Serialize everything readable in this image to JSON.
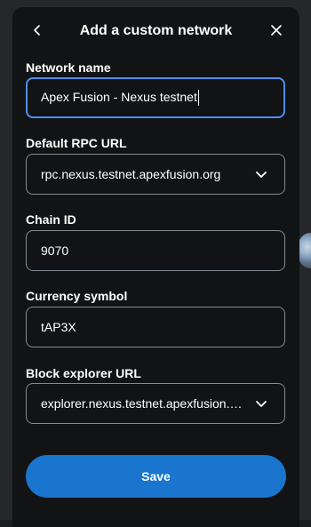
{
  "header": {
    "title": "Add a custom network",
    "back_icon": "chevron-left-icon",
    "close_icon": "close-icon"
  },
  "form": {
    "network_name": {
      "label": "Network name",
      "value": "Apex Fusion - Nexus testnet"
    },
    "rpc_url": {
      "label": "Default RPC URL",
      "value": "rpc.nexus.testnet.apexfusion.org",
      "icon": "chevron-down-icon"
    },
    "chain_id": {
      "label": "Chain ID",
      "value": "9070"
    },
    "currency_symbol": {
      "label": "Currency symbol",
      "value": "tAP3X"
    },
    "explorer_url": {
      "label": "Block explorer URL",
      "value": "explorer.nexus.testnet.apexfusion.org",
      "icon": "chevron-down-icon"
    }
  },
  "actions": {
    "save_label": "Save"
  },
  "colors": {
    "modal_bg": "#121314",
    "accent": "#1a75ce",
    "focus_border": "#4f8ef7",
    "field_border": "#858b92"
  }
}
